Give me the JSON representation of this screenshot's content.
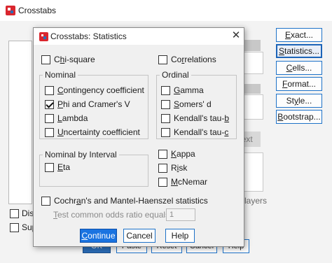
{
  "background_window": {
    "title": "Crosstabs",
    "side_buttons": [
      {
        "label": "Exact...",
        "ul": "E",
        "rest": "xact..."
      },
      {
        "label": "Statistics...",
        "ul": "S",
        "rest": "tatistics..."
      },
      {
        "label": "Cells...",
        "ul": "C",
        "rest": "ells..."
      },
      {
        "label": "Format...",
        "ul": "F",
        "rest": "ormat..."
      },
      {
        "label": "Style...",
        "ul": "y",
        "pre": "St",
        "rest": "le..."
      },
      {
        "label": "Bootstrap...",
        "ul": "B",
        "rest": "ootstrap..."
      }
    ],
    "partial_texts": {
      "next": "Next",
      "layers": "layers"
    },
    "bottom_checks": [
      {
        "label": "Disp"
      },
      {
        "label": "Sup"
      }
    ],
    "bottom_buttons": [
      "OK",
      "Paste",
      "Reset",
      "Cancel",
      "Help"
    ]
  },
  "dialog": {
    "title": "Crosstabs: Statistics",
    "chi_square": {
      "ul": "h",
      "pre": "C",
      "rest": "i-square",
      "checked": false
    },
    "correlations": {
      "ul": "r",
      "pre": "Co",
      "rest": "relations",
      "checked": false
    },
    "nominal": {
      "label": "Nominal",
      "items": [
        {
          "ul": "C",
          "pre": "",
          "rest": "ontingency coefficient",
          "checked": false
        },
        {
          "ul": "P",
          "pre": "",
          "rest": "hi and Cramer's V",
          "checked": true
        },
        {
          "ul": "L",
          "pre": "",
          "rest": "ambda",
          "checked": false
        },
        {
          "ul": "U",
          "pre": "",
          "rest": "ncertainty coefficient",
          "checked": false
        }
      ]
    },
    "ordinal": {
      "label": "Ordinal",
      "items": [
        {
          "ul": "G",
          "pre": "",
          "rest": "amma",
          "checked": false
        },
        {
          "ul": "S",
          "pre": "",
          "rest": "omers' d",
          "checked": false
        },
        {
          "ul": "b",
          "pre": "Kendall's tau-",
          "rest": "",
          "checked": false
        },
        {
          "ul": "c",
          "pre": "Kendall's tau-",
          "rest": "",
          "checked": false
        }
      ]
    },
    "nominal_by_interval": {
      "label": "Nominal by Interval",
      "items": [
        {
          "ul": "E",
          "pre": "",
          "rest": "ta",
          "checked": false
        }
      ]
    },
    "right_checks": [
      {
        "ul": "K",
        "pre": "",
        "rest": "appa",
        "checked": false
      },
      {
        "ul": "i",
        "pre": "R",
        "rest": "sk",
        "checked": false
      },
      {
        "ul": "M",
        "pre": "",
        "rest": "cNemar",
        "checked": false
      }
    ],
    "cochran": {
      "pre": "Cochr",
      "ul": "a",
      "rest": "n's and Mantel-Haenszel statistics",
      "checked": false
    },
    "odds_ratio": {
      "label": "Test common odds ratio equals:",
      "ul": "T",
      "rest": "est common odds ratio equals:",
      "value": "1"
    },
    "buttons": {
      "continue": {
        "ul": "C",
        "rest": "ontinue"
      },
      "cancel": {
        "label": "Cancel"
      },
      "help": {
        "label": "Help"
      }
    }
  },
  "colors": {
    "accent": "#1a73e0",
    "border_blue": "#1e72c8",
    "logo_red": "#d9262e",
    "logo_blue": "#2b6cb6"
  },
  "icons": {
    "close": "close-icon",
    "logo": "app-logo-icon"
  }
}
